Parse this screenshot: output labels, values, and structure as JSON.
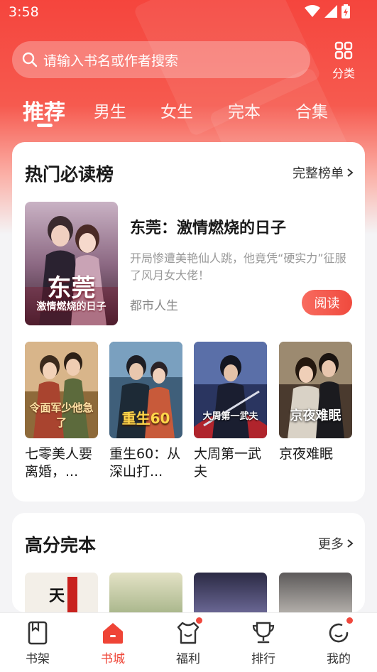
{
  "status_bar": {
    "time": "3:58"
  },
  "search": {
    "placeholder": "请输入书名或作者搜索"
  },
  "category": {
    "label": "分类"
  },
  "tabs": [
    {
      "label": "推荐",
      "active": true
    },
    {
      "label": "男生",
      "active": false
    },
    {
      "label": "女生",
      "active": false
    },
    {
      "label": "完本",
      "active": false
    },
    {
      "label": "合集",
      "active": false
    }
  ],
  "hot_section": {
    "title": "热门必读榜",
    "more_label": "完整榜单",
    "featured": {
      "title": "东莞：激情燃烧的日子",
      "description": "开局惨遭美艳仙人跳，他竟凭“硬实力”征服了风月女大佬！",
      "genre": "都市人生",
      "read_label": "阅读",
      "cover_text_big": "东莞",
      "cover_text_small": "激情燃烧的日子"
    },
    "books": [
      {
        "title": "七零美人要离婚，...",
        "cover_text": "令面军少他急了"
      },
      {
        "title": "重生60：从深山打...",
        "cover_text": "重生60"
      },
      {
        "title": "大周第一武夫",
        "cover_text": "大周第一武夫"
      },
      {
        "title": "京夜难眠",
        "cover_text": "京夜难眠"
      }
    ]
  },
  "complete_section": {
    "title": "高分完本",
    "more_label": "更多"
  },
  "bottom_nav": [
    {
      "label": "书架",
      "icon": "bookshelf-icon",
      "active": false,
      "badge": false
    },
    {
      "label": "书城",
      "icon": "home-icon",
      "active": true,
      "badge": false
    },
    {
      "label": "福利",
      "icon": "gift-shirt-icon",
      "active": false,
      "badge": true
    },
    {
      "label": "排行",
      "icon": "trophy-icon",
      "active": false,
      "badge": false
    },
    {
      "label": "我的",
      "icon": "profile-icon",
      "active": false,
      "badge": true
    }
  ],
  "colors": {
    "accent": "#ef4436",
    "hero_top": "#f5453d"
  }
}
